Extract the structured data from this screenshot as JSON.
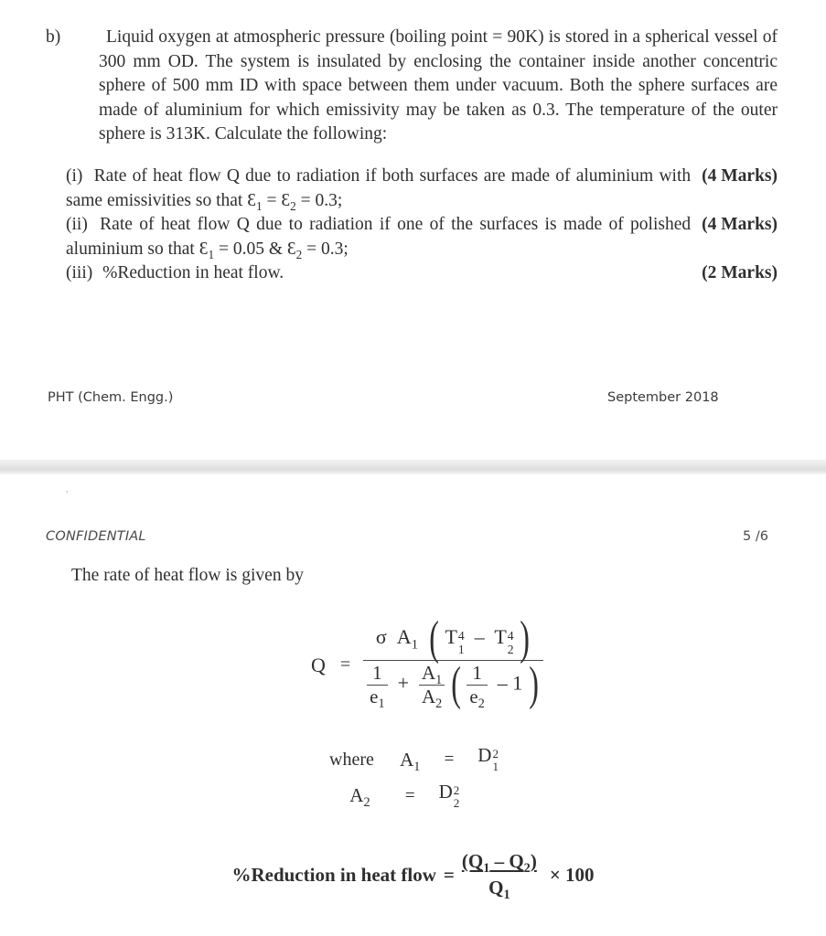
{
  "page_one": {
    "question_label": "b)",
    "question_text": "Liquid oxygen at atmospheric pressure (boiling point = 90K) is stored in a spherical vessel of 300 mm OD. The system is insulated by enclosing the container inside another concentric sphere of 500 mm ID with space between them under vacuum. Both the sphere surfaces are made of aluminium for which emissivity may be taken as 0.3. The temperature of the outer sphere is 313K. Calculate the following:",
    "sub_questions": [
      {
        "roman": "(i)",
        "text_before": "Rate of heat flow Q due to radiation if both surfaces are made of aluminium with same emissivities so that",
        "formula": "Ɛ1 = Ɛ2 = 0.3;",
        "marks": "(4 Marks)"
      },
      {
        "roman": "(ii)",
        "text_before": "Rate of heat flow Q due to radiation if one of the surfaces is made of polished aluminium so that",
        "formula": "Ɛ1 = 0.05 & Ɛ2 = 0.3;",
        "marks": "(4 Marks)"
      },
      {
        "roman": "(iii)",
        "text_before": "%Reduction in heat flow.",
        "formula": "",
        "marks": "(2 Marks)"
      }
    ],
    "footer_left": "PHT (Chem. Engg.)",
    "footer_right": "September 2018"
  },
  "page_two": {
    "scan_mark": "ʼ",
    "confidential": "CONFIDENTIAL",
    "page_number": "5 /6",
    "intro_line": "The rate of heat flow is given by",
    "main_equation": {
      "lhs": "Q",
      "equals": "=",
      "numerator": {
        "sigma": "σ",
        "area": "A",
        "area_sub": "1",
        "t1": "T",
        "t1_sub": "1",
        "t1_sup": "4",
        "minus": "–",
        "t2": "T",
        "t2_sub": "2",
        "t2_sup": "4"
      },
      "denominator": {
        "term1_num": "1",
        "term1_den": "e",
        "term1_den_sub": "1",
        "plus": "+",
        "term2_num": "A",
        "term2_num_sub": "1",
        "term2_den": "A",
        "term2_den_sub": "2",
        "inner_num": "1",
        "inner_den": "e",
        "inner_den_sub": "2",
        "inner_minus": "–",
        "inner_one": "1"
      }
    },
    "where_block": {
      "label": "where",
      "top_left": "A",
      "top_left_sub": "1",
      "top_equals": "=",
      "top_right": "D",
      "top_right_sub": "1",
      "top_right_sup": "2",
      "bottom_left": "A",
      "bottom_left_sub": "2",
      "bottom_equals": "=",
      "bottom_right": "D",
      "bottom_right_sub": "2",
      "bottom_right_sup": "2"
    },
    "percent_reduction": {
      "label": "%Reduction in heat flow",
      "equals": "=",
      "numerator_open": "(Q",
      "numerator_sub1": "1",
      "numerator_minus": " – Q",
      "numerator_sub2": "2",
      "numerator_close": ")",
      "denominator": "Q",
      "denominator_sub": "1",
      "tail": "× 100"
    }
  }
}
